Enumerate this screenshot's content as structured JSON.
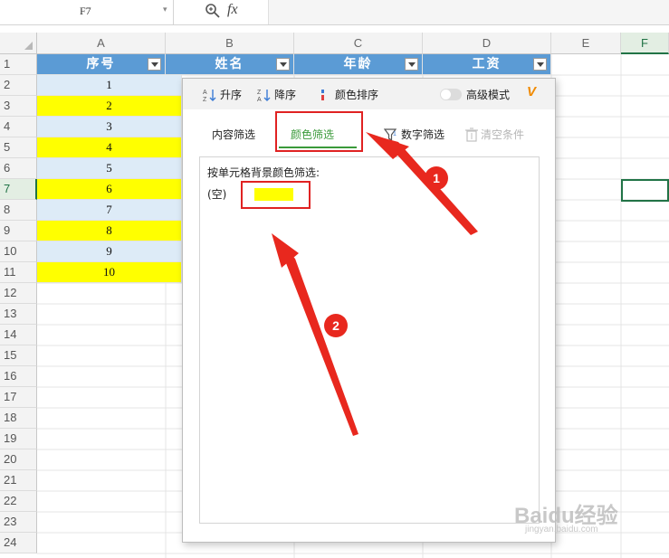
{
  "formula_bar": {
    "name_box": "F7",
    "fx": "fx"
  },
  "columns": [
    "A",
    "B",
    "C",
    "D",
    "E",
    "F"
  ],
  "rows": [
    "1",
    "2",
    "3",
    "4",
    "5",
    "6",
    "7",
    "8",
    "9",
    "10",
    "11",
    "12",
    "13",
    "14",
    "15",
    "16",
    "17",
    "18",
    "19",
    "20",
    "21",
    "22",
    "23",
    "24"
  ],
  "header_row": {
    "a": "序号",
    "b": "姓名",
    "c": "年龄",
    "d": "工资"
  },
  "column_a_values": [
    "1",
    "2",
    "3",
    "4",
    "5",
    "6",
    "7",
    "8",
    "9",
    "10"
  ],
  "colors": {
    "header_blue": "#5b9bd5",
    "row_yellow": "#ffff00",
    "row_lightblue": "#ddebf7",
    "accent_green": "#3a9a3a",
    "annotation_red": "#e02222"
  },
  "filter_panel": {
    "sort_asc": "升序",
    "sort_desc": "降序",
    "sort_color": "颜色排序",
    "advanced_mode": "高级模式",
    "vip_badge": "V",
    "tabs": {
      "content": "内容筛选",
      "color": "颜色筛选",
      "number": "数字筛选",
      "clear": "清空条件"
    },
    "color_label": "按单元格背景颜色筛选:",
    "color_option_text": "(空)",
    "color_option_swatch": "#ffff00"
  },
  "annotations": {
    "badge_1": "1",
    "badge_2": "2"
  },
  "watermark": {
    "main": "Baidu经验",
    "sub": "jingyan.baidu.com"
  }
}
